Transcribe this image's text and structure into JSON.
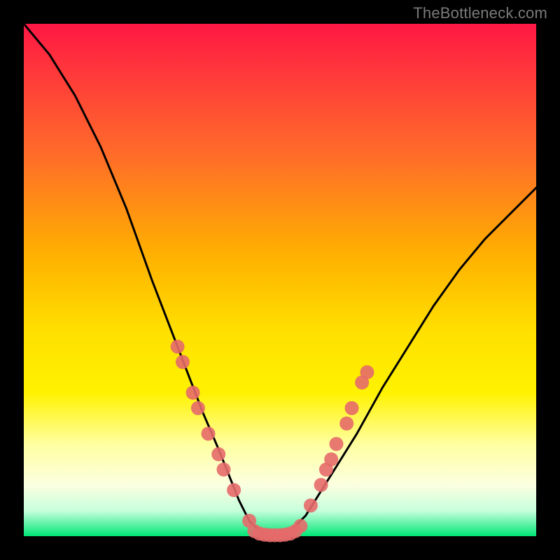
{
  "watermark": "TheBottleneck.com",
  "colors": {
    "background": "#000000",
    "curve_stroke": "#000000",
    "marker_fill": "#e66a6a",
    "marker_stroke": "#c04848",
    "gradient_top": "#ff1744",
    "gradient_bottom": "#00e676"
  },
  "chart_data": {
    "type": "line",
    "title": "",
    "xlabel": "",
    "ylabel": "",
    "xlim": [
      0,
      100
    ],
    "ylim": [
      0,
      100
    ],
    "x": [
      0,
      5,
      10,
      15,
      20,
      25,
      30,
      35,
      38,
      40,
      42,
      44,
      46,
      48,
      50,
      52,
      55,
      60,
      65,
      70,
      75,
      80,
      85,
      90,
      95,
      100
    ],
    "series": [
      {
        "name": "bottleneck-curve",
        "values": [
          100,
          94,
          86,
          76,
          64,
          50,
          37,
          24,
          17,
          12,
          7,
          3,
          1,
          0,
          0,
          1,
          4,
          12,
          20,
          29,
          37,
          45,
          52,
          58,
          63,
          68
        ]
      }
    ],
    "markers": {
      "name": "highlight-points",
      "points": [
        {
          "x": 30,
          "y": 37
        },
        {
          "x": 31,
          "y": 34
        },
        {
          "x": 33,
          "y": 28
        },
        {
          "x": 34,
          "y": 25
        },
        {
          "x": 36,
          "y": 20
        },
        {
          "x": 38,
          "y": 16
        },
        {
          "x": 39,
          "y": 13
        },
        {
          "x": 41,
          "y": 9
        },
        {
          "x": 44,
          "y": 3
        },
        {
          "x": 45,
          "y": 1
        },
        {
          "x": 46,
          "y": 0.5
        },
        {
          "x": 47,
          "y": 0.3
        },
        {
          "x": 48,
          "y": 0.2
        },
        {
          "x": 49,
          "y": 0.2
        },
        {
          "x": 50,
          "y": 0.2
        },
        {
          "x": 51,
          "y": 0.3
        },
        {
          "x": 52,
          "y": 0.5
        },
        {
          "x": 53,
          "y": 1
        },
        {
          "x": 54,
          "y": 2
        },
        {
          "x": 56,
          "y": 6
        },
        {
          "x": 58,
          "y": 10
        },
        {
          "x": 59,
          "y": 13
        },
        {
          "x": 60,
          "y": 15
        },
        {
          "x": 61,
          "y": 18
        },
        {
          "x": 63,
          "y": 22
        },
        {
          "x": 64,
          "y": 25
        },
        {
          "x": 66,
          "y": 30
        },
        {
          "x": 67,
          "y": 32
        }
      ]
    }
  }
}
